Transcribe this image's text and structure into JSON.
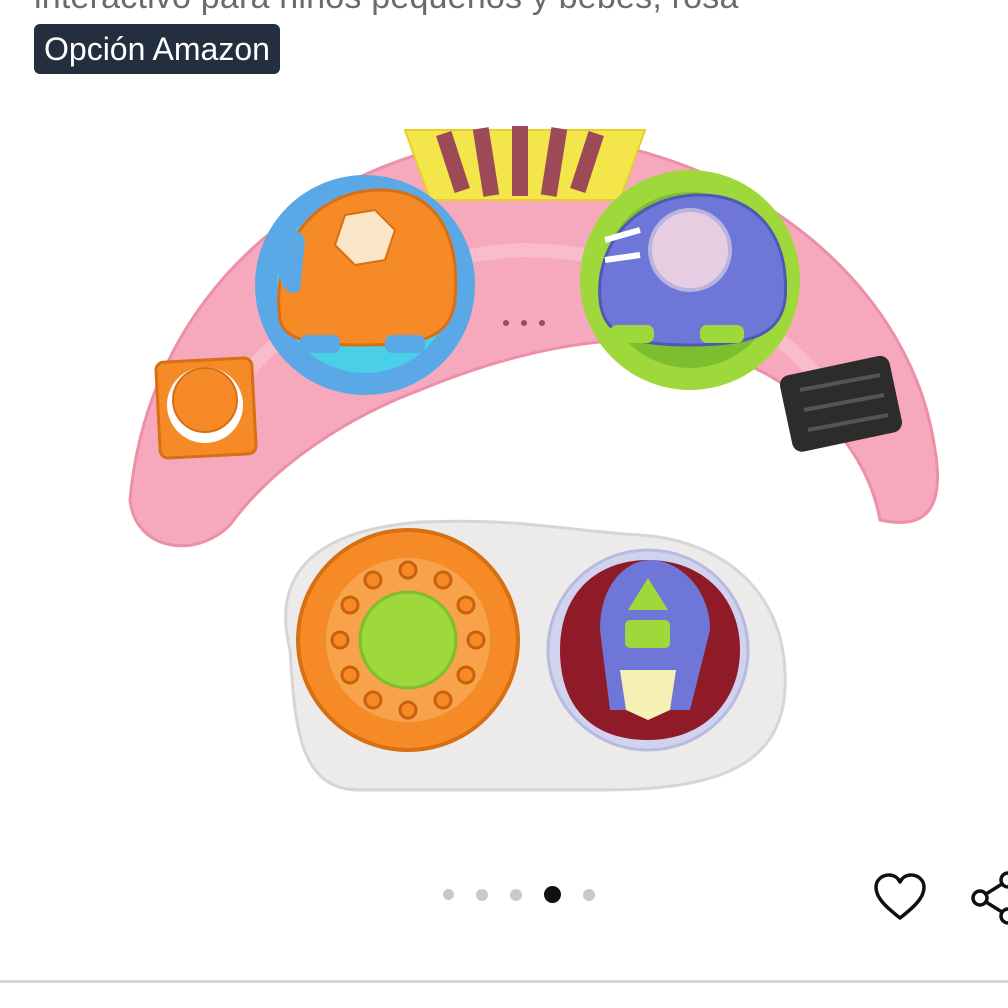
{
  "product": {
    "title_fragment": "interactivo para niños pequeños y bebés, rosa",
    "badge_label": "Opción Amazon",
    "image_alt": "Juguete de volante interactivo rosa para bebés"
  },
  "carousel": {
    "dot_count": 5,
    "active_index": 3
  },
  "actions": {
    "favorite_icon": "heart-icon",
    "share_icon": "share-icon"
  },
  "colors": {
    "badge_bg": "#232f3e",
    "dot_active": "#0f1111",
    "dot_inactive": "#c9c9c9",
    "toy_pink": "#f6a9bd",
    "toy_yellow": "#f4e64a",
    "toy_orange": "#f58a26",
    "toy_blue": "#5aa9e6",
    "toy_purple": "#6e76d8",
    "toy_green": "#9fd83a"
  }
}
